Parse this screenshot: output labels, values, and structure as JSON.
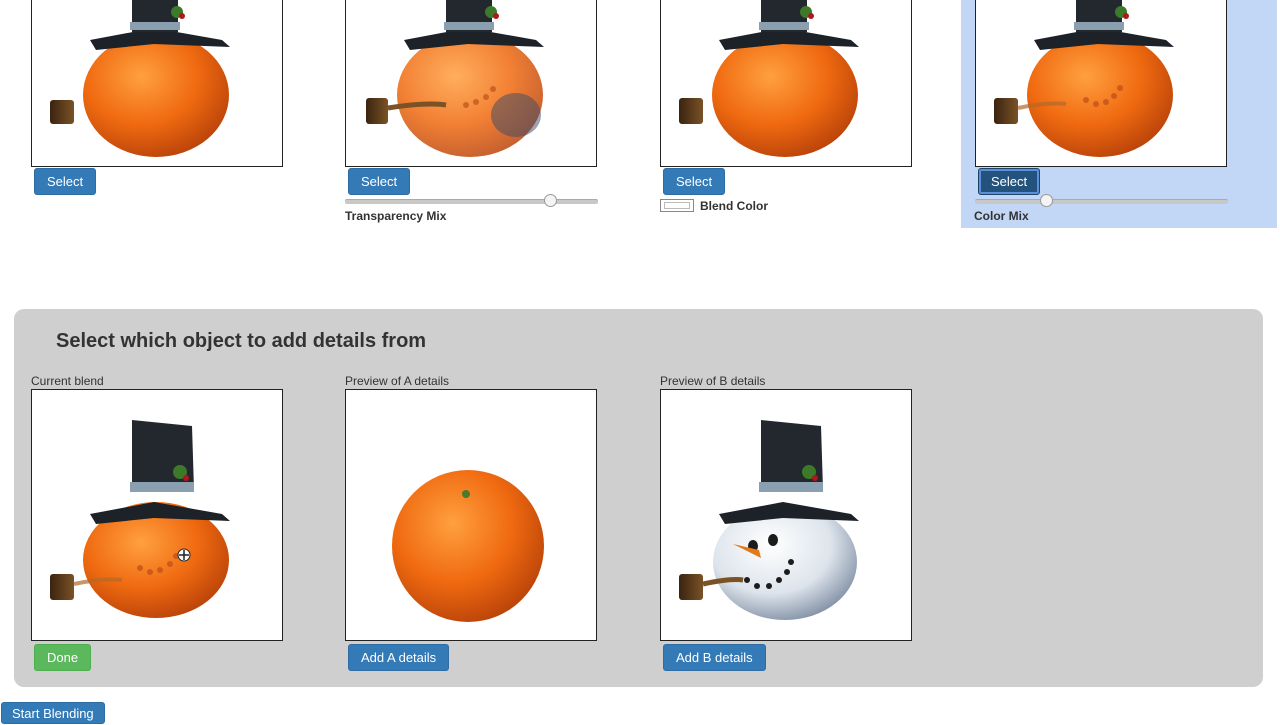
{
  "top_row": {
    "select_label": "Select",
    "transparency_label": "Transparency Mix",
    "transparency_value": 0.83,
    "blend_color_label": "Blend Color",
    "color_mix_label": "Color Mix",
    "color_mix_value": 0.27
  },
  "details_panel": {
    "title": "Select which object to add details from",
    "current_caption": "Current blend",
    "preview_a_caption": "Preview of A details",
    "preview_b_caption": "Preview of B details",
    "done_label": "Done",
    "add_a_label": "Add A details",
    "add_b_label": "Add B details"
  },
  "footer": {
    "start_label": "Start Blending"
  },
  "colors": {
    "primary_button": "#337ab7",
    "success_button": "#5cb85c",
    "highlight": "#c2d6f5",
    "panel": "#cfcfcf"
  }
}
